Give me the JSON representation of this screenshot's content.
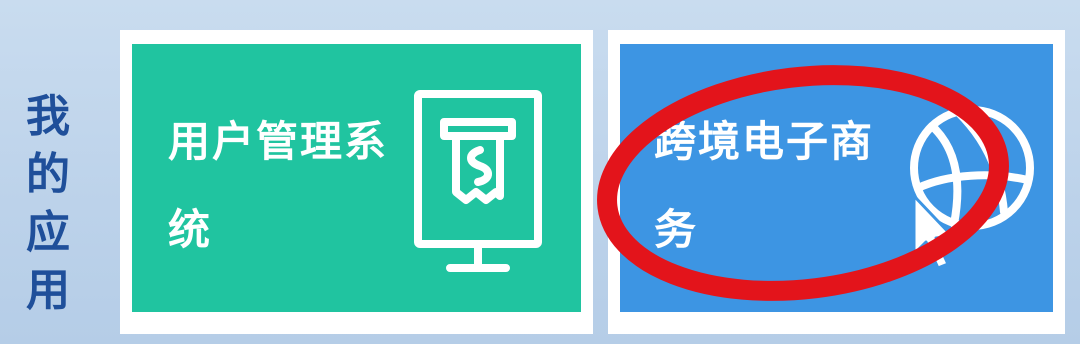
{
  "section": {
    "title_chars": [
      "我",
      "的",
      "应",
      "用"
    ]
  },
  "apps": [
    {
      "label": "用户管理系\n统",
      "icon": "monitor-receipt-icon",
      "color": "#20c4a0"
    },
    {
      "label": "跨境电子商\n务",
      "icon": "globe-cursor-icon",
      "color": "#3d95e3",
      "highlighted": true
    }
  ],
  "highlight_color": "#e3141b"
}
